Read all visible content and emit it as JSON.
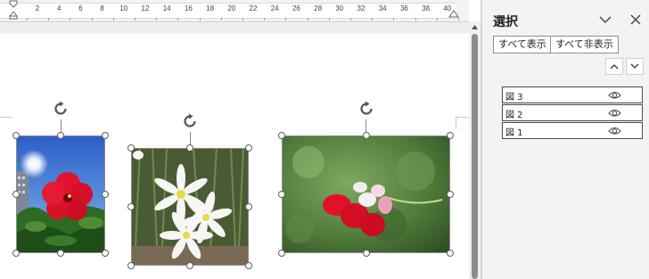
{
  "ruler": {
    "labels": [
      "2",
      "4",
      "6",
      "8",
      "10",
      "12",
      "14",
      "16",
      "18",
      "20",
      "22",
      "24",
      "26",
      "28",
      "30",
      "32",
      "34",
      "36",
      "38",
      "40"
    ]
  },
  "document": {
    "images": [
      {
        "name": "図 1",
        "kind": "red-hibiscus-photo"
      },
      {
        "name": "図 2",
        "kind": "white-rain-lilies-photo"
      },
      {
        "name": "図 3",
        "kind": "red-geranium-photo"
      }
    ]
  },
  "pane": {
    "title": "選択",
    "show_all": "すべて表示",
    "hide_all": "すべて非表示",
    "items": [
      {
        "label": "図 3",
        "visible": true
      },
      {
        "label": "図 2",
        "visible": true
      },
      {
        "label": "図 1",
        "visible": true
      }
    ]
  },
  "icons": {
    "collapse": "chevron-down-icon",
    "close": "close-icon",
    "bring_forward": "chevron-up-icon",
    "send_backward": "chevron-down-icon",
    "visibility": "eye-icon",
    "rotate": "rotate-icon"
  },
  "colors": {
    "pane_bg": "#f3f3f3",
    "thumb": "#8c8c8c"
  }
}
